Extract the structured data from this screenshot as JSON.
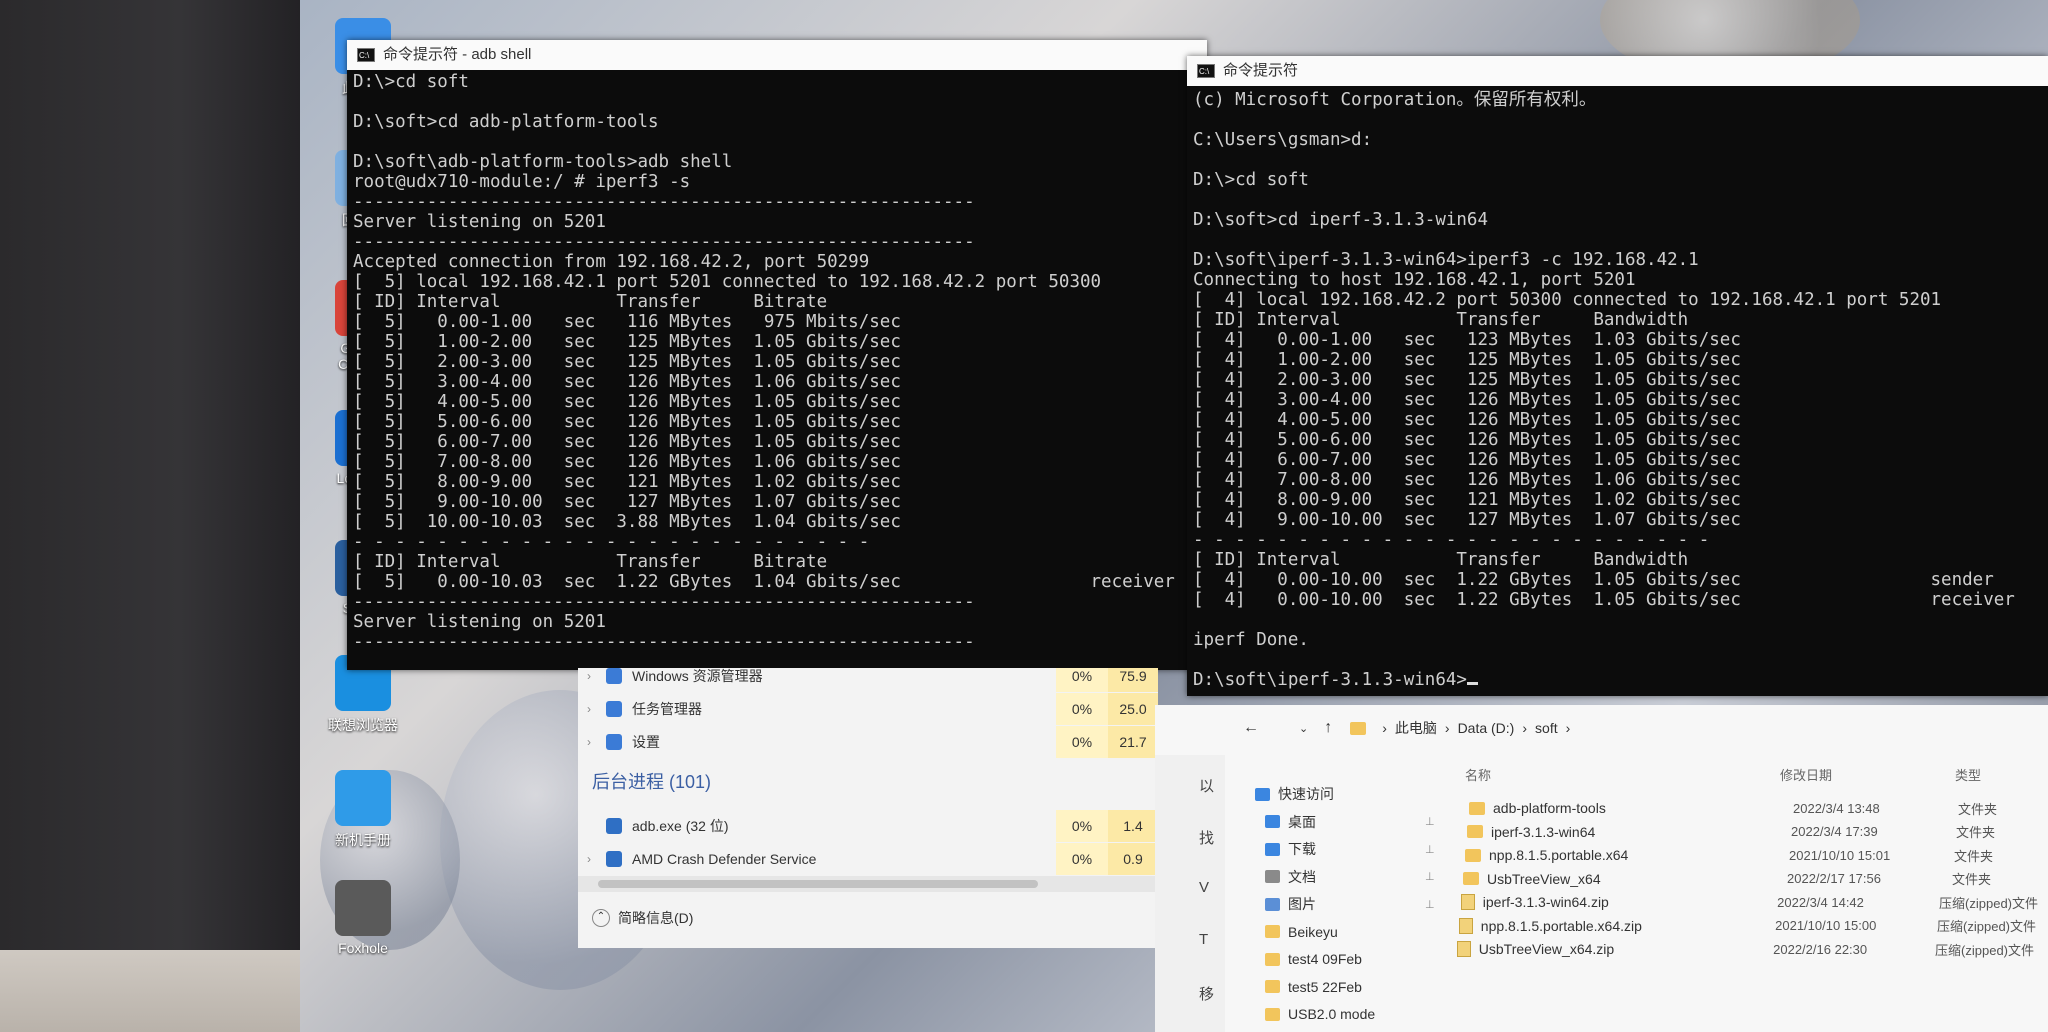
{
  "left_terminal": {
    "title": "命令提示符 - adb shell",
    "lines": [
      "D:\\>cd soft",
      "",
      "D:\\soft>cd adb-platform-tools",
      "",
      "D:\\soft\\adb-platform-tools>adb shell",
      "root@udx710-module:/ # iperf3 -s",
      "-----------------------------------------------------------",
      "Server listening on 5201",
      "-----------------------------------------------------------",
      "Accepted connection from 192.168.42.2, port 50299",
      "[  5] local 192.168.42.1 port 5201 connected to 192.168.42.2 port 50300",
      "[ ID] Interval           Transfer     Bitrate",
      "[  5]   0.00-1.00   sec   116 MBytes   975 Mbits/sec",
      "[  5]   1.00-2.00   sec   125 MBytes  1.05 Gbits/sec",
      "[  5]   2.00-3.00   sec   125 MBytes  1.05 Gbits/sec",
      "[  5]   3.00-4.00   sec   126 MBytes  1.06 Gbits/sec",
      "[  5]   4.00-5.00   sec   126 MBytes  1.05 Gbits/sec",
      "[  5]   5.00-6.00   sec   126 MBytes  1.05 Gbits/sec",
      "[  5]   6.00-7.00   sec   126 MBytes  1.05 Gbits/sec",
      "[  5]   7.00-8.00   sec   126 MBytes  1.06 Gbits/sec",
      "[  5]   8.00-9.00   sec   121 MBytes  1.02 Gbits/sec",
      "[  5]   9.00-10.00  sec   127 MBytes  1.07 Gbits/sec",
      "[  5]  10.00-10.03  sec  3.88 MBytes  1.04 Gbits/sec",
      "- - - - - - - - - - - - - - - - - - - - - - - - -",
      "[ ID] Interval           Transfer     Bitrate",
      "[  5]   0.00-10.03  sec  1.22 GBytes  1.04 Gbits/sec                  receiver",
      "-----------------------------------------------------------",
      "Server listening on 5201",
      "-----------------------------------------------------------"
    ]
  },
  "right_terminal": {
    "title": "命令提示符",
    "lines": [
      "(c) Microsoft Corporation。保留所有权利。",
      "",
      "C:\\Users\\gsman>d:",
      "",
      "D:\\>cd soft",
      "",
      "D:\\soft>cd iperf-3.1.3-win64",
      "",
      "D:\\soft\\iperf-3.1.3-win64>iperf3 -c 192.168.42.1",
      "Connecting to host 192.168.42.1, port 5201",
      "[  4] local 192.168.42.2 port 50300 connected to 192.168.42.1 port 5201",
      "[ ID] Interval           Transfer     Bandwidth",
      "[  4]   0.00-1.00   sec   123 MBytes  1.03 Gbits/sec",
      "[  4]   1.00-2.00   sec   125 MBytes  1.05 Gbits/sec",
      "[  4]   2.00-3.00   sec   125 MBytes  1.05 Gbits/sec",
      "[  4]   3.00-4.00   sec   126 MBytes  1.05 Gbits/sec",
      "[  4]   4.00-5.00   sec   126 MBytes  1.05 Gbits/sec",
      "[  4]   5.00-6.00   sec   126 MBytes  1.05 Gbits/sec",
      "[  4]   6.00-7.00   sec   126 MBytes  1.05 Gbits/sec",
      "[  4]   7.00-8.00   sec   126 MBytes  1.06 Gbits/sec",
      "[  4]   8.00-9.00   sec   121 MBytes  1.02 Gbits/sec",
      "[  4]   9.00-10.00  sec   127 MBytes  1.07 Gbits/sec",
      "- - - - - - - - - - - - - - - - - - - - - - - - -",
      "[ ID] Interval           Transfer     Bandwidth",
      "[  4]   0.00-10.00  sec  1.22 GBytes  1.05 Gbits/sec                  sender",
      "[  4]   0.00-10.00  sec  1.22 GBytes  1.05 Gbits/sec                  receiver",
      "",
      "iperf Done.",
      "",
      "D:\\soft\\iperf-3.1.3-win64>"
    ]
  },
  "desktop_icons": [
    {
      "label": "此电脑",
      "icon": "this-pc-icon",
      "color": "#3a8ee6"
    },
    {
      "label": "回收站",
      "icon": "recycle-bin-icon",
      "color": "#7fb0e0"
    },
    {
      "label": "Google Chrome",
      "icon": "chrome-icon",
      "color": "#d9443a"
    },
    {
      "label": "Logitech",
      "icon": "logitech-icon",
      "color": "#1b6fd1"
    },
    {
      "label": "Steam",
      "icon": "steam-icon",
      "color": "#2a5f9e"
    },
    {
      "label": "联想浏览器",
      "icon": "lenovo-browser-icon",
      "color": "#1a8fe0"
    },
    {
      "label": "新机手册",
      "icon": "manual-icon",
      "color": "#2f9be8"
    },
    {
      "label": "Foxhole",
      "icon": "foxhole-icon",
      "color": "#5a5a5a"
    }
  ],
  "task_manager": {
    "rows": [
      {
        "name": "Windows 资源管理器",
        "cpu": "0%",
        "mem": "75.9"
      },
      {
        "name": "任务管理器",
        "cpu": "0%",
        "mem": "25.0"
      },
      {
        "name": "设置",
        "cpu": "0%",
        "mem": "21.7"
      }
    ],
    "section": "后台进程 (101)",
    "bg_rows": [
      {
        "name": "adb.exe (32 位)",
        "cpu": "0%",
        "mem": "1.4"
      },
      {
        "name": "AMD Crash Defender Service",
        "cpu": "0%",
        "mem": "0.9"
      }
    ],
    "footer": "简略信息(D)"
  },
  "explorer": {
    "breadcrumb": [
      "此电脑",
      "Data (D:)",
      "soft"
    ],
    "columns": {
      "name": "名称",
      "date": "修改日期",
      "type": "类型"
    },
    "nav": [
      {
        "label": "快速访问",
        "kind": "star"
      },
      {
        "label": "桌面",
        "kind": "desktop"
      },
      {
        "label": "下载",
        "kind": "download"
      },
      {
        "label": "文档",
        "kind": "document"
      },
      {
        "label": "图片",
        "kind": "picture"
      },
      {
        "label": "Beikeyu",
        "kind": "folder"
      },
      {
        "label": "test4 09Feb",
        "kind": "folder"
      },
      {
        "label": "test5 22Feb",
        "kind": "folder"
      },
      {
        "label": "USB2.0 mode",
        "kind": "folder"
      }
    ],
    "side_letters": [
      "以",
      "找",
      "V",
      "T",
      "移"
    ],
    "files": [
      {
        "name": "adb-platform-tools",
        "date": "2022/3/4 13:48",
        "type": "文件夹",
        "kind": "folder"
      },
      {
        "name": "iperf-3.1.3-win64",
        "date": "2022/3/4 17:39",
        "type": "文件夹",
        "kind": "folder"
      },
      {
        "name": "npp.8.1.5.portable.x64",
        "date": "2021/10/10 15:01",
        "type": "文件夹",
        "kind": "folder"
      },
      {
        "name": "UsbTreeView_x64",
        "date": "2022/2/17 17:56",
        "type": "文件夹",
        "kind": "folder"
      },
      {
        "name": "iperf-3.1.3-win64.zip",
        "date": "2022/3/4 14:42",
        "type": "压缩(zipped)文件",
        "kind": "zip"
      },
      {
        "name": "npp.8.1.5.portable.x64.zip",
        "date": "2021/10/10 15:00",
        "type": "压缩(zipped)文件",
        "kind": "zip"
      },
      {
        "name": "UsbTreeView_x64.zip",
        "date": "2022/2/16 22:30",
        "type": "压缩(zipped)文件",
        "kind": "zip"
      }
    ]
  }
}
